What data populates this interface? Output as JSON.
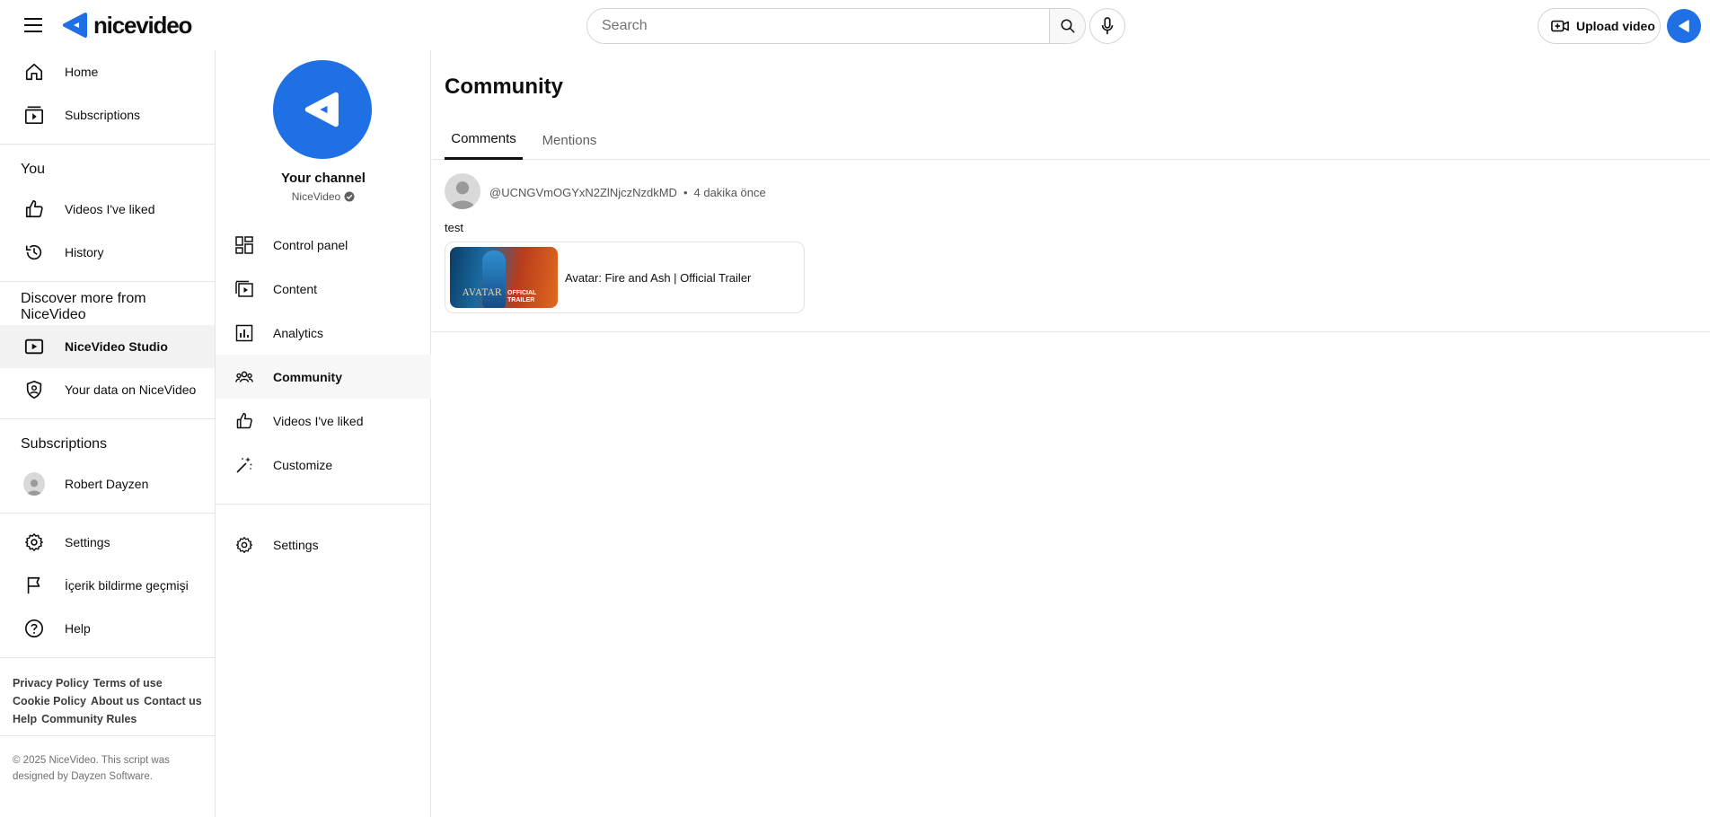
{
  "brand": {
    "name": "nicevideo",
    "accent": "#1f6fe5"
  },
  "header": {
    "search_placeholder": "Search",
    "upload_label": "Upload video"
  },
  "sidebar": {
    "primary": [
      {
        "label": "Home",
        "icon": "home-icon"
      },
      {
        "label": "Subscriptions",
        "icon": "subscriptions-icon"
      }
    ],
    "you_heading": "You",
    "you_items": [
      {
        "label": "Videos I've liked",
        "icon": "thumb-up-icon"
      },
      {
        "label": "History",
        "icon": "history-icon"
      }
    ],
    "discover_heading": "Discover more from NiceVideo",
    "discover_items": [
      {
        "label": "NiceVideo Studio",
        "icon": "studio-icon",
        "active": true
      },
      {
        "label": "Your data on NiceVideo",
        "icon": "shield-user-icon"
      }
    ],
    "subscriptions_heading": "Subscriptions",
    "subscriptions": [
      {
        "label": "Robert Dayzen"
      }
    ],
    "misc_items": [
      {
        "label": "Settings",
        "icon": "gear-icon"
      },
      {
        "label": "İçerik bildirme geçmişi",
        "icon": "flag-icon"
      },
      {
        "label": "Help",
        "icon": "help-icon"
      }
    ],
    "footer_links": [
      "Privacy Policy",
      "Terms of use",
      "Cookie Policy",
      "About us",
      "Contact us",
      "Help",
      "Community Rules"
    ],
    "copyright_line1": "© 2025 NiceVideo. This script was",
    "copyright_line2": "designed by Dayzen Software."
  },
  "channel": {
    "title": "Your channel",
    "handle": "NiceVideo",
    "nav": [
      {
        "label": "Control panel",
        "icon": "dashboard-icon"
      },
      {
        "label": "Content",
        "icon": "content-icon"
      },
      {
        "label": "Analytics",
        "icon": "analytics-icon"
      },
      {
        "label": "Community",
        "icon": "community-icon",
        "active": true
      },
      {
        "label": "Videos I've liked",
        "icon": "thumb-up-icon"
      },
      {
        "label": "Customize",
        "icon": "magic-wand-icon"
      }
    ],
    "settings_label": "Settings"
  },
  "main": {
    "title": "Community",
    "tabs": [
      {
        "label": "Comments",
        "active": true
      },
      {
        "label": "Mentions",
        "active": false
      }
    ],
    "comments": [
      {
        "author": "@UCNGVmOGYxN2ZlNjczNzdkMD",
        "separator": "•",
        "time": "4 dakika önce",
        "text": "test",
        "video": {
          "title": "Avatar: Fire and Ash | Official Trailer",
          "thumb_text_main": "AVATAR",
          "thumb_text_badge_1": "OFFICIAL",
          "thumb_text_badge_2": "TRAILER"
        }
      }
    ]
  }
}
